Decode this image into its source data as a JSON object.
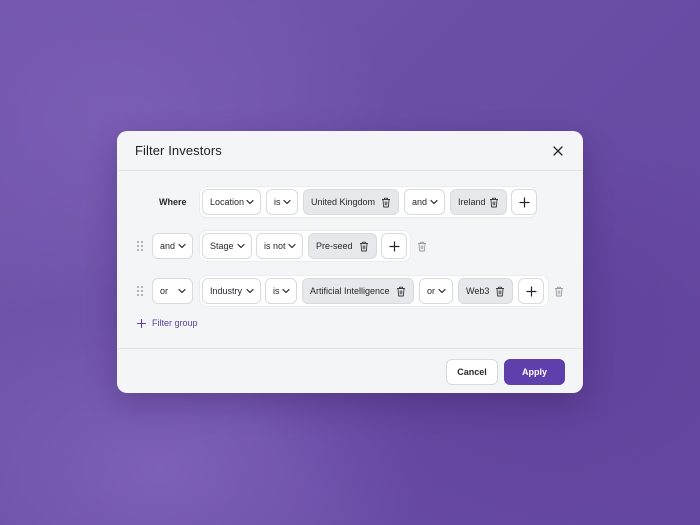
{
  "dialog": {
    "title": "Filter Investors"
  },
  "filter": {
    "where_label": "Where",
    "rows": [
      {
        "connector": "",
        "field": "Location",
        "operator": "is",
        "values": [
          "United Kingdom",
          "Ireland"
        ],
        "value_joiner": "and"
      },
      {
        "connector": "and",
        "field": "Stage",
        "operator": "is not",
        "values": [
          "Pre-seed"
        ]
      },
      {
        "connector": "or",
        "field": "Industry",
        "operator": "is",
        "values": [
          "Artificial Intelligence",
          "Web3"
        ],
        "value_joiner": "or"
      }
    ],
    "add_group_label": "Filter group"
  },
  "footer": {
    "cancel_label": "Cancel",
    "apply_label": "Apply"
  },
  "colors": {
    "accent": "#5e3fab",
    "background": "#6a4ea6",
    "modal": "#f4f5f6"
  },
  "icons": {
    "close": "close-icon",
    "chevron": "chevron-down-icon",
    "trash": "trash-icon",
    "plus": "plus-icon",
    "drag": "drag-handle-icon"
  }
}
